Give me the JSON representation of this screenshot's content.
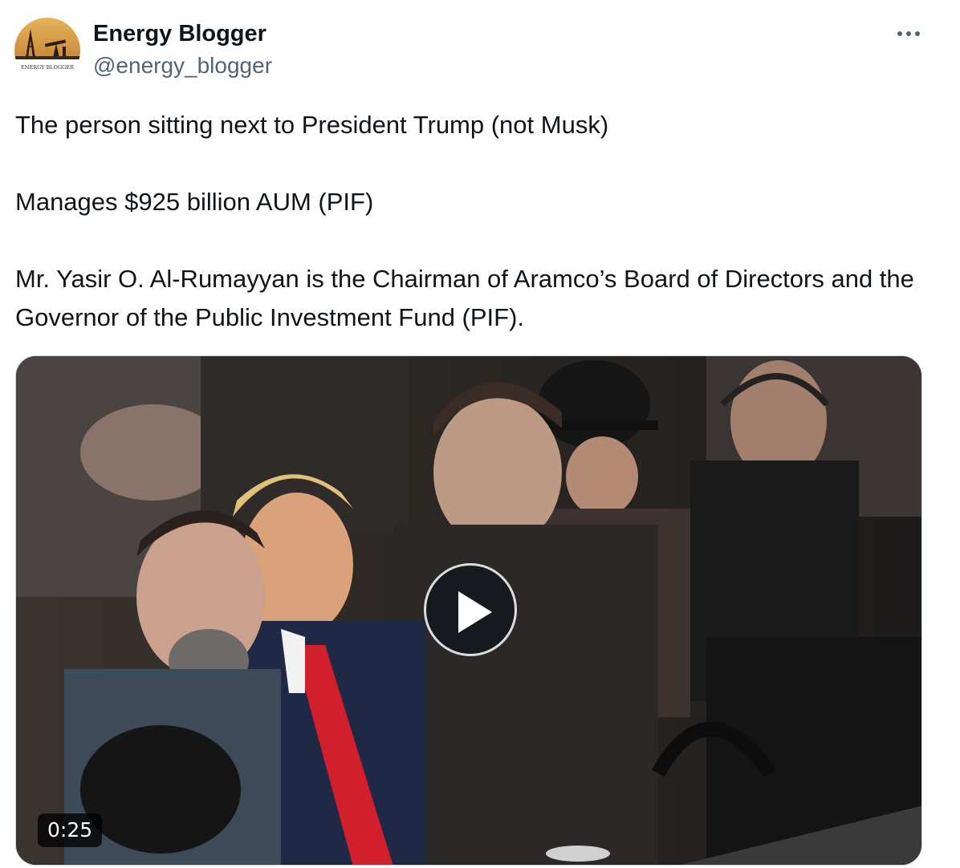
{
  "author": {
    "name": "Energy Blogger",
    "handle": "@energy_blogger",
    "avatar_text": "ENERGY BLOGGER"
  },
  "tweet": {
    "paragraphs": [
      "The person sitting next to President Trump (not Musk)",
      "Manages $925 billion AUM (PIF)",
      "Mr. Yasir O. Al-Rumayyan is the Chairman of Aramco’s Board of Directors and the Governor of the Public Investment Fund (PIF)."
    ]
  },
  "media": {
    "type": "video",
    "duration": "0:25",
    "play_icon": "play-icon"
  },
  "icons": {
    "more": "more-options-icon"
  },
  "colors": {
    "text_primary": "#0f1419",
    "text_secondary": "#536471",
    "border": "#cfd9de",
    "tie_red": "#d1202c"
  }
}
